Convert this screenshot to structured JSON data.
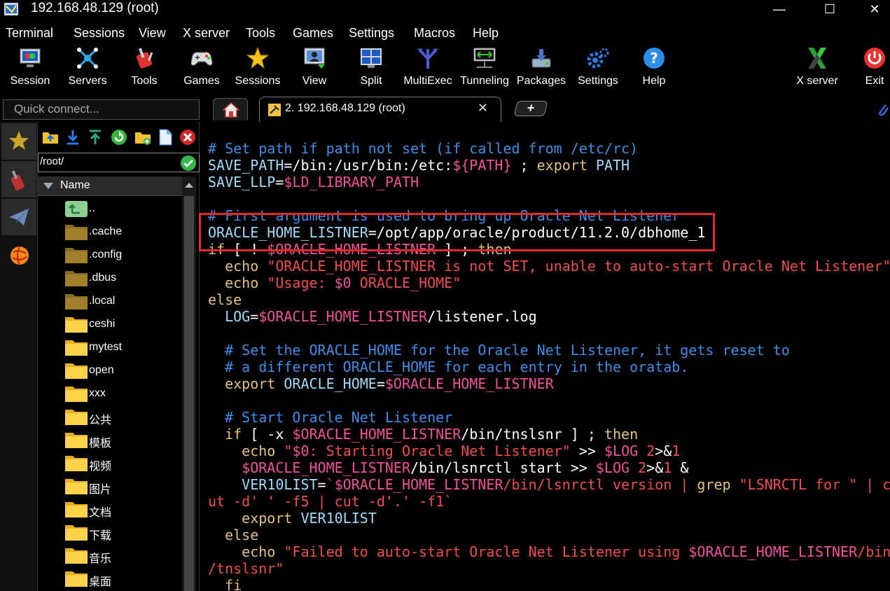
{
  "window": {
    "title": "192.168.48.129 (root)",
    "min_glyph": "—",
    "max_glyph": "☐",
    "close_glyph": "✕"
  },
  "menu": [
    "Terminal",
    "Sessions",
    "View",
    "X server",
    "Tools",
    "Games",
    "Settings",
    "Macros",
    "Help"
  ],
  "toolbar": [
    {
      "label": "Session",
      "icon": "session-icon"
    },
    {
      "label": "Servers",
      "icon": "servers-icon"
    },
    {
      "label": "Tools",
      "icon": "tools-icon"
    },
    {
      "label": "Games",
      "icon": "games-icon"
    },
    {
      "label": "Sessions",
      "icon": "sessions-star-icon"
    },
    {
      "label": "View",
      "icon": "view-icon"
    },
    {
      "label": "Split",
      "icon": "split-icon"
    },
    {
      "label": "MultiExec",
      "icon": "multiexec-icon"
    },
    {
      "label": "Tunneling",
      "icon": "tunneling-icon"
    },
    {
      "label": "Packages",
      "icon": "packages-icon"
    },
    {
      "label": "Settings",
      "icon": "settings-icon"
    },
    {
      "label": "Help",
      "icon": "help-icon"
    },
    {
      "label": "X server",
      "icon": "xserver-icon"
    },
    {
      "label": "Exit",
      "icon": "exit-icon"
    }
  ],
  "quick_connect": {
    "placeholder": "Quick connect..."
  },
  "tabs": {
    "session_label": "2. 192.168.48.129 (root)",
    "close_glyph": "✕",
    "new_tab_glyph": "+"
  },
  "filebrowser": {
    "path": "/root/",
    "column_name": "Name",
    "items": [
      {
        "name": "..",
        "type": "parent"
      },
      {
        "name": ".cache",
        "type": "hidden-folder"
      },
      {
        "name": ".config",
        "type": "hidden-folder"
      },
      {
        "name": ".dbus",
        "type": "hidden-folder"
      },
      {
        "name": ".local",
        "type": "hidden-folder"
      },
      {
        "name": "ceshi",
        "type": "folder"
      },
      {
        "name": "mytest",
        "type": "folder"
      },
      {
        "name": "open",
        "type": "folder"
      },
      {
        "name": "xxx",
        "type": "folder"
      },
      {
        "name": "公共",
        "type": "folder"
      },
      {
        "name": "模板",
        "type": "folder"
      },
      {
        "name": "视频",
        "type": "folder"
      },
      {
        "name": "图片",
        "type": "folder"
      },
      {
        "name": "文档",
        "type": "folder"
      },
      {
        "name": "下载",
        "type": "folder"
      },
      {
        "name": "音乐",
        "type": "folder"
      },
      {
        "name": "桌面",
        "type": "folder"
      }
    ]
  },
  "terminal": {
    "lines": [
      [
        [
          "c",
          "# Set path if path not set (if called from /etc/rc)"
        ]
      ],
      [
        [
          "v",
          "SAVE_PATH"
        ],
        [
          "w",
          "=/bin:/usr/bin:/etc:"
        ],
        [
          "p",
          "${PATH}"
        ],
        [
          "w",
          " ; "
        ],
        [
          "k",
          "export"
        ],
        [
          "w",
          " "
        ],
        [
          "v",
          "PATH"
        ]
      ],
      [
        [
          "v",
          "SAVE_LLP"
        ],
        [
          "w",
          "="
        ],
        [
          "p",
          "$LD_LIBRARY_PATH"
        ]
      ],
      [
        [
          "w",
          ""
        ]
      ],
      [
        [
          "c",
          "# First argument is used to bring up Oracle Net Listener"
        ]
      ],
      [
        [
          "v",
          "ORACLE_HOME_LISTNER"
        ],
        [
          "w",
          "=/opt/app/oracle/product/11.2.0/dbhome_1"
        ]
      ],
      [
        [
          "k",
          "if"
        ],
        [
          "w",
          " [ ! "
        ],
        [
          "p",
          "$ORACLE_HOME_LISTNER"
        ],
        [
          "w",
          " ] ; "
        ],
        [
          "k",
          "then"
        ]
      ],
      [
        [
          "w",
          "  "
        ],
        [
          "k",
          "echo"
        ],
        [
          "w",
          " "
        ],
        [
          "s",
          "\"ORACLE_HOME_LISTNER is not SET, unable to auto-start Oracle Net Listener\""
        ]
      ],
      [
        [
          "w",
          "  "
        ],
        [
          "k",
          "echo"
        ],
        [
          "w",
          " "
        ],
        [
          "s",
          "\"Usage: "
        ],
        [
          "p",
          "$0"
        ],
        [
          "s",
          " ORACLE_HOME\""
        ]
      ],
      [
        [
          "k",
          "else"
        ]
      ],
      [
        [
          "w",
          "  "
        ],
        [
          "v",
          "LOG"
        ],
        [
          "w",
          "="
        ],
        [
          "p",
          "$ORACLE_HOME_LISTNER"
        ],
        [
          "w",
          "/listener.log"
        ]
      ],
      [
        [
          "w",
          ""
        ]
      ],
      [
        [
          "w",
          "  "
        ],
        [
          "c",
          "# Set the ORACLE_HOME for the Oracle Net Listener, it gets reset to"
        ]
      ],
      [
        [
          "w",
          "  "
        ],
        [
          "c",
          "# a different ORACLE_HOME for each entry in the oratab."
        ]
      ],
      [
        [
          "w",
          "  "
        ],
        [
          "k",
          "export"
        ],
        [
          "w",
          " "
        ],
        [
          "v",
          "ORACLE_HOME"
        ],
        [
          "w",
          "="
        ],
        [
          "p",
          "$ORACLE_HOME_LISTNER"
        ]
      ],
      [
        [
          "w",
          ""
        ]
      ],
      [
        [
          "w",
          "  "
        ],
        [
          "c",
          "# Start Oracle Net Listener"
        ]
      ],
      [
        [
          "w",
          "  "
        ],
        [
          "k",
          "if"
        ],
        [
          "w",
          " [ -x "
        ],
        [
          "p",
          "$ORACLE_HOME_LISTNER"
        ],
        [
          "w",
          "/bin/tnslsnr ] ; "
        ],
        [
          "k",
          "then"
        ]
      ],
      [
        [
          "w",
          "    "
        ],
        [
          "k",
          "echo"
        ],
        [
          "w",
          " "
        ],
        [
          "s",
          "\""
        ],
        [
          "p",
          "$0"
        ],
        [
          "s",
          ": Starting Oracle Net Listener\""
        ],
        [
          "w",
          " >> "
        ],
        [
          "p",
          "$LOG"
        ],
        [
          "w",
          " "
        ],
        [
          "s",
          "2"
        ],
        [
          "w",
          ">&"
        ],
        [
          "s",
          "1"
        ]
      ],
      [
        [
          "w",
          "    "
        ],
        [
          "p",
          "$ORACLE_HOME_LISTNER"
        ],
        [
          "w",
          "/bin/lsnrctl start >> "
        ],
        [
          "p",
          "$LOG"
        ],
        [
          "w",
          " "
        ],
        [
          "s",
          "2"
        ],
        [
          "w",
          ">&"
        ],
        [
          "s",
          "1"
        ],
        [
          "w",
          " &"
        ]
      ],
      [
        [
          "w",
          "    "
        ],
        [
          "v",
          "VER10LIST"
        ],
        [
          "w",
          "="
        ],
        [
          "s",
          "`"
        ],
        [
          "p",
          "$ORACLE_HOME_LISTNER"
        ],
        [
          "s",
          "/bin/lsnrctl version | "
        ],
        [
          "k",
          "grep"
        ],
        [
          "s",
          " \"LSNRCTL for \" | c"
        ]
      ],
      [
        [
          "s",
          "ut -d' ' -f5 | cut -d'.' -f1`"
        ]
      ],
      [
        [
          "w",
          "    "
        ],
        [
          "k",
          "export"
        ],
        [
          "w",
          " "
        ],
        [
          "v",
          "VER10LIST"
        ]
      ],
      [
        [
          "w",
          "  "
        ],
        [
          "k",
          "else"
        ]
      ],
      [
        [
          "w",
          "    "
        ],
        [
          "k",
          "echo"
        ],
        [
          "w",
          " "
        ],
        [
          "s",
          "\"Failed to auto-start Oracle Net Listener using "
        ],
        [
          "p",
          "$ORACLE_HOME_LISTNER"
        ],
        [
          "s",
          "/bin"
        ]
      ],
      [
        [
          "s",
          "/tnslsnr\""
        ]
      ],
      [
        [
          "w",
          "  "
        ],
        [
          "k",
          "fi"
        ]
      ]
    ]
  }
}
